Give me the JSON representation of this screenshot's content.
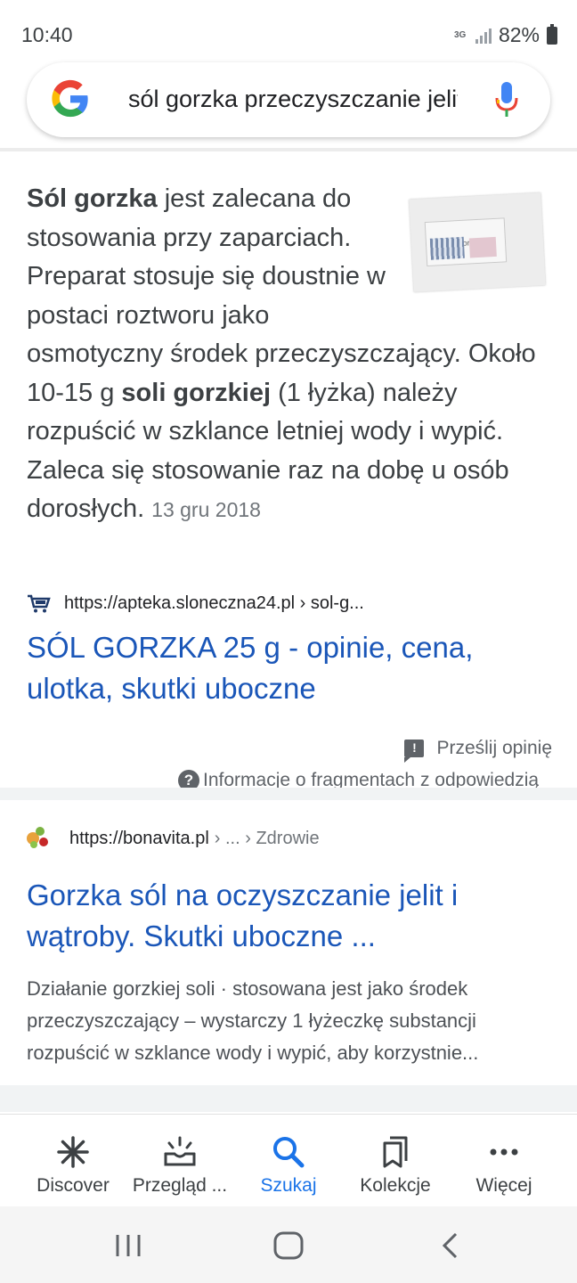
{
  "status_bar": {
    "time": "10:40",
    "network": "3G",
    "battery": "82%"
  },
  "search": {
    "query": "sól gorzka przeczyszczanie jelit"
  },
  "snippet": {
    "bold_term": "Sól gorzka",
    "text_part1": " jest zalecana do stosowania przy zaparciach. Preparat stosuje się doustnie w postaci roztworu jako osmotyczny środek przeczyszczający. Około 10-15 g ",
    "bold_term2": "soli gorzkiej",
    "text_part2": " (1 łyżka) należy rozpuścić w szklance letniej wody i wypić. Zaleca się stosowanie raz na dobę u osób dorosłych.",
    "date": "13 gru 2018",
    "image_label": "Sól gorzka",
    "source_url": "https://apteka.sloneczna24.pl › sol-g...",
    "title": "SÓL GORZKA 25 g - opinie, cena, ulotka, skutki uboczne",
    "feedback_label": "Prześlij opinię",
    "info_label": "Informacje o fragmentach z odpowiedzią"
  },
  "result": {
    "url": "https://bonavita.pl",
    "url_path": "› ... › Zdrowie",
    "title": "Gorzka sól na oczyszczanie jelit i wątroby. Skutki uboczne ...",
    "description": "Działanie gorzkiej soli · stosowana jest jako środek przeczyszczający – wystarczy 1 łyżeczkę substancji rozpuścić w szklance wody i wypić, aby korzystnie..."
  },
  "bottom_nav": {
    "items": [
      {
        "label": "Discover",
        "icon": "asterisk-icon"
      },
      {
        "label": "Przegląd ...",
        "icon": "updates-icon"
      },
      {
        "label": "Szukaj",
        "icon": "search-icon",
        "active": true
      },
      {
        "label": "Kolekcje",
        "icon": "collections-icon"
      },
      {
        "label": "Więcej",
        "icon": "more-icon"
      }
    ]
  },
  "colors": {
    "link": "#1a56b8",
    "active_nav": "#1a73e8",
    "text": "#3c4043",
    "muted": "#70757a"
  }
}
